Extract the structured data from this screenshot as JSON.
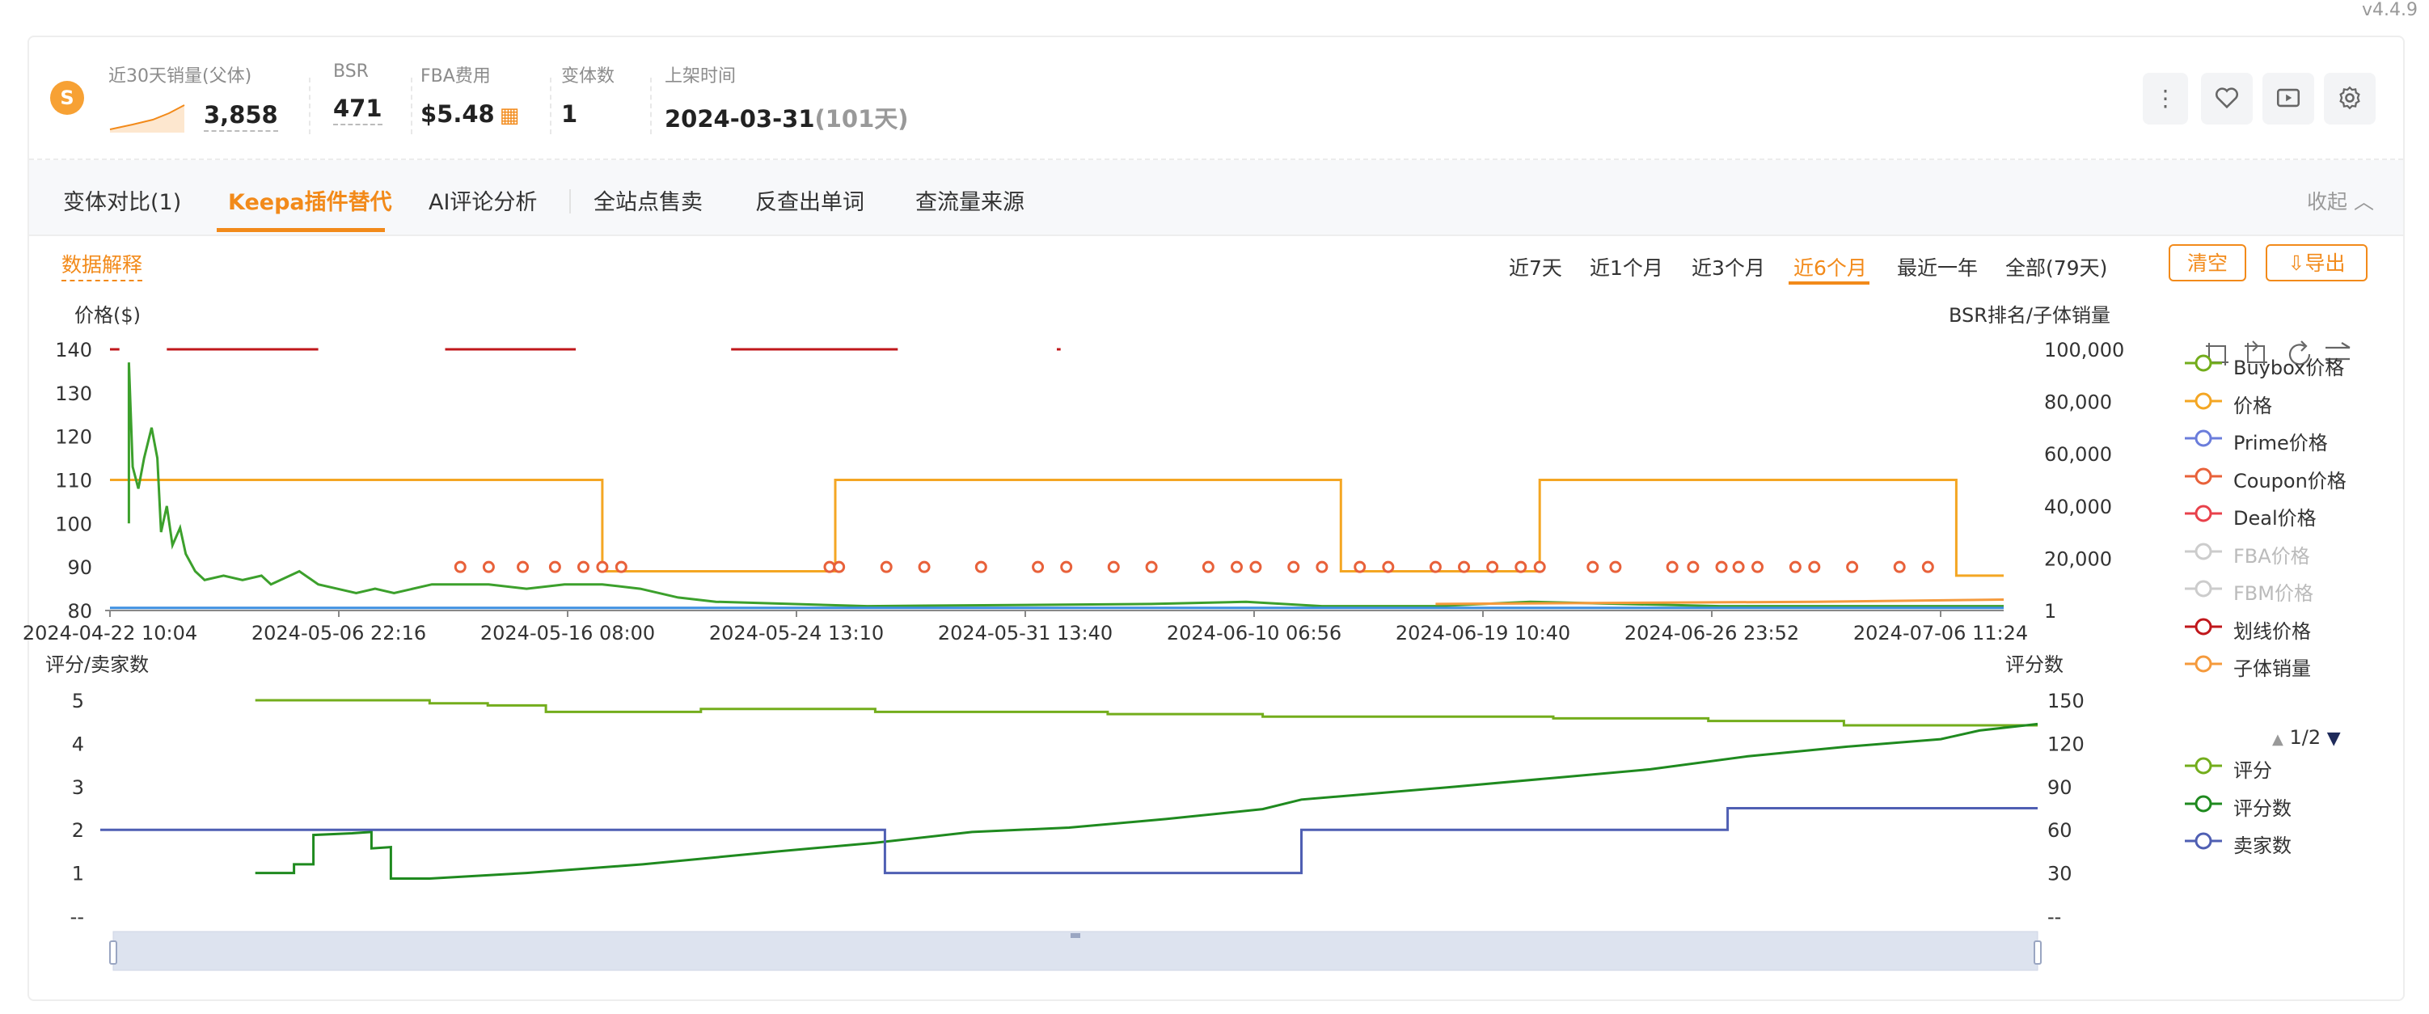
{
  "version": "v4.4.9",
  "header": {
    "stats": [
      {
        "label": "近30天销量(父体)",
        "value": "3,858"
      },
      {
        "label": "BSR",
        "value": "471"
      },
      {
        "label": "FBA费用",
        "value": "$5.48"
      },
      {
        "label": "变体数",
        "value": "1"
      },
      {
        "label": "上架时间",
        "value": "2024-03-31",
        "suffix": "(101天)"
      }
    ],
    "icons": [
      "more-icon",
      "heart-icon",
      "video-icon",
      "settings-icon"
    ]
  },
  "tabs": [
    {
      "label": "变体对比(1)"
    },
    {
      "label": "Keepa插件替代",
      "active": true
    },
    {
      "label": "AI评论分析"
    },
    {
      "label": "全站点售卖"
    },
    {
      "label": "反查出单词"
    },
    {
      "label": "查流量来源"
    }
  ],
  "collapse_label": "收起",
  "explain_label": "数据解释",
  "ranges": [
    {
      "label": "近7天"
    },
    {
      "label": "近1个月"
    },
    {
      "label": "近3个月"
    },
    {
      "label": "近6个月",
      "active": true
    },
    {
      "label": "最近一年"
    },
    {
      "label": "全部(79天)"
    }
  ],
  "buttons": {
    "clear": "清空",
    "export": "导出"
  },
  "legend_top": [
    {
      "name": "Buybox价格",
      "color": "#73ad1c",
      "on": true
    },
    {
      "name": "价格",
      "color": "#f4a623",
      "on": true
    },
    {
      "name": "Prime价格",
      "color": "#6b7ddb",
      "on": true
    },
    {
      "name": "Coupon价格",
      "color": "#e8613a",
      "on": true
    },
    {
      "name": "Deal价格",
      "color": "#e8414b",
      "on": true
    },
    {
      "name": "FBA价格",
      "color": "#cccccc",
      "on": false
    },
    {
      "name": "FBM价格",
      "color": "#cccccc",
      "on": false
    },
    {
      "name": "划线价格",
      "color": "#c0171b",
      "on": true
    },
    {
      "name": "子体销量",
      "color": "#f59a3c",
      "on": true
    }
  ],
  "legend_pager": "1/2",
  "legend_bottom": [
    {
      "name": "评分",
      "color": "#73ad1c"
    },
    {
      "name": "评分数",
      "color": "#1f8a1f"
    },
    {
      "name": "卖家数",
      "color": "#4f5fb3"
    }
  ],
  "chart_data": [
    {
      "type": "line",
      "ylabel": "价格($)",
      "y2label": "BSR排名/子体销量",
      "ylim": [
        80,
        140
      ],
      "y_ticks": [
        140,
        130,
        120,
        110,
        100,
        90,
        80
      ],
      "y2_ticks": [
        "100,000",
        "80,000",
        "60,000",
        "40,000",
        "20,000",
        "1"
      ],
      "x_ticks": [
        "2024-04-22 10:04",
        "2024-05-06 22:16",
        "2024-05-16 08:00",
        "2024-05-24 13:10",
        "2024-05-31 13:40",
        "2024-06-10 06:56",
        "2024-06-19 10:40",
        "2024-06-26 23:52",
        "2024-07-06 11:24"
      ],
      "series": [
        {
          "name": "价格",
          "color": "#f4a623",
          "points": [
            [
              0,
              110
            ],
            [
              0.26,
              110
            ],
            [
              0.26,
              89
            ],
            [
              0.383,
              89
            ],
            [
              0.383,
              110
            ],
            [
              0.65,
              110
            ],
            [
              0.65,
              89
            ],
            [
              0.755,
              89
            ],
            [
              0.755,
              110
            ],
            [
              0.975,
              110
            ],
            [
              0.975,
              88
            ],
            [
              1,
              88
            ]
          ]
        },
        {
          "name": "划线价格",
          "color": "#c0171b",
          "segments": [
            [
              [
                0.0,
                140
              ],
              [
                0.005,
                140
              ]
            ],
            [
              [
                0.03,
                140
              ],
              [
                0.11,
                140
              ]
            ],
            [
              [
                0.177,
                140
              ],
              [
                0.246,
                140
              ]
            ],
            [
              [
                0.328,
                140
              ],
              [
                0.416,
                140
              ]
            ],
            [
              [
                0.5,
                140
              ],
              [
                0.502,
                140
              ]
            ]
          ]
        },
        {
          "name": "Coupon价格",
          "color": "#e8613a",
          "dots": [
            [
              0.185,
              90
            ],
            [
              0.2,
              90
            ],
            [
              0.218,
              90
            ],
            [
              0.235,
              90
            ],
            [
              0.25,
              90
            ],
            [
              0.26,
              90
            ],
            [
              0.27,
              90
            ],
            [
              0.38,
              90
            ],
            [
              0.385,
              90
            ],
            [
              0.41,
              90
            ],
            [
              0.43,
              90
            ],
            [
              0.46,
              90
            ],
            [
              0.49,
              90
            ],
            [
              0.505,
              90
            ],
            [
              0.53,
              90
            ],
            [
              0.55,
              90
            ],
            [
              0.58,
              90
            ],
            [
              0.595,
              90
            ],
            [
              0.605,
              90
            ],
            [
              0.625,
              90
            ],
            [
              0.64,
              90
            ],
            [
              0.66,
              90
            ],
            [
              0.675,
              90
            ],
            [
              0.7,
              90
            ],
            [
              0.715,
              90
            ],
            [
              0.73,
              90
            ],
            [
              0.745,
              90
            ],
            [
              0.755,
              90
            ],
            [
              0.783,
              90
            ],
            [
              0.795,
              90
            ],
            [
              0.825,
              90
            ],
            [
              0.836,
              90
            ],
            [
              0.851,
              90
            ],
            [
              0.86,
              90
            ],
            [
              0.87,
              90
            ],
            [
              0.89,
              90
            ],
            [
              0.9,
              90
            ],
            [
              0.92,
              90
            ],
            [
              0.945,
              90
            ],
            [
              0.96,
              90
            ]
          ]
        },
        {
          "name": "Buybox价格",
          "color": "#3ca02c",
          "points": [
            [
              0.01,
              100
            ],
            [
              0.01,
              137
            ],
            [
              0.012,
              113
            ],
            [
              0.015,
              108
            ],
            [
              0.018,
              115
            ],
            [
              0.022,
              122
            ],
            [
              0.025,
              115
            ],
            [
              0.027,
              98
            ],
            [
              0.03,
              104
            ],
            [
              0.033,
              95
            ],
            [
              0.037,
              99
            ],
            [
              0.04,
              93
            ],
            [
              0.045,
              89
            ],
            [
              0.05,
              87
            ],
            [
              0.06,
              88
            ],
            [
              0.07,
              87
            ],
            [
              0.08,
              88
            ],
            [
              0.085,
              86
            ],
            [
              0.1,
              89
            ],
            [
              0.11,
              86
            ],
            [
              0.12,
              85
            ],
            [
              0.13,
              84
            ],
            [
              0.14,
              85
            ],
            [
              0.15,
              84
            ],
            [
              0.17,
              86
            ],
            [
              0.2,
              86
            ],
            [
              0.22,
              85
            ],
            [
              0.24,
              86
            ],
            [
              0.26,
              86
            ],
            [
              0.28,
              85
            ],
            [
              0.3,
              83
            ],
            [
              0.32,
              82
            ],
            [
              0.4,
              81
            ],
            [
              0.55,
              81.5
            ],
            [
              0.6,
              82
            ],
            [
              0.64,
              81
            ],
            [
              0.66,
              81
            ],
            [
              0.7,
              81
            ],
            [
              0.75,
              82
            ],
            [
              0.85,
              81
            ],
            [
              0.95,
              81
            ],
            [
              1,
              81
            ]
          ]
        },
        {
          "name": "子体销量",
          "color": "#f59a3c",
          "points": [
            [
              0.7,
              81.5
            ],
            [
              0.9,
              82
            ],
            [
              1,
              82.5
            ]
          ]
        },
        {
          "name": "Prime价格",
          "color": "#3d8fe0",
          "points": [
            [
              0,
              80.6
            ],
            [
              1,
              80.6
            ]
          ]
        }
      ]
    },
    {
      "type": "line",
      "ylabel": "评分/卖家数",
      "y2label": "评分数",
      "y_ticks": [
        "5",
        "4",
        "3",
        "2",
        "1",
        "--"
      ],
      "y2_ticks": [
        "150",
        "120",
        "90",
        "60",
        "30",
        "--"
      ],
      "series": [
        {
          "name": "评分",
          "color": "#73ad1c",
          "points": [
            [
              0.08,
              5
            ],
            [
              0.17,
              5
            ],
            [
              0.17,
              4.93
            ],
            [
              0.2,
              4.93
            ],
            [
              0.2,
              4.88
            ],
            [
              0.23,
              4.88
            ],
            [
              0.23,
              4.73
            ],
            [
              0.31,
              4.73
            ],
            [
              0.31,
              4.8
            ],
            [
              0.4,
              4.8
            ],
            [
              0.4,
              4.73
            ],
            [
              0.52,
              4.73
            ],
            [
              0.52,
              4.68
            ],
            [
              0.6,
              4.68
            ],
            [
              0.6,
              4.62
            ],
            [
              0.75,
              4.62
            ],
            [
              0.75,
              4.58
            ],
            [
              0.83,
              4.58
            ],
            [
              0.83,
              4.52
            ],
            [
              0.9,
              4.52
            ],
            [
              0.9,
              4.42
            ],
            [
              1,
              4.42
            ]
          ]
        },
        {
          "name": "评分数",
          "color": "#1f8a1f",
          "points": [
            [
              0.08,
              1
            ],
            [
              0.1,
              1
            ],
            [
              0.1,
              1.2
            ],
            [
              0.11,
              1.2
            ],
            [
              0.11,
              1.88
            ],
            [
              0.13,
              1.92
            ],
            [
              0.14,
              1.95
            ],
            [
              0.14,
              1.57
            ],
            [
              0.15,
              1.6
            ],
            [
              0.15,
              0.87
            ],
            [
              0.17,
              0.87
            ],
            [
              0.22,
              1.0
            ],
            [
              0.28,
              1.2
            ],
            [
              0.35,
              1.5
            ],
            [
              0.4,
              1.7
            ],
            [
              0.45,
              1.95
            ],
            [
              0.5,
              2.05
            ],
            [
              0.55,
              2.25
            ],
            [
              0.6,
              2.48
            ],
            [
              0.62,
              2.7
            ],
            [
              0.7,
              3.0
            ],
            [
              0.75,
              3.2
            ],
            [
              0.8,
              3.4
            ],
            [
              0.85,
              3.7
            ],
            [
              0.9,
              3.92
            ],
            [
              0.95,
              4.1
            ],
            [
              0.97,
              4.3
            ],
            [
              1,
              4.45
            ]
          ]
        },
        {
          "name": "卖家数",
          "color": "#4f5fb3",
          "points": [
            [
              0,
              2
            ],
            [
              0.405,
              2
            ],
            [
              0.405,
              1
            ],
            [
              0.62,
              1
            ],
            [
              0.62,
              2
            ],
            [
              0.84,
              2
            ],
            [
              0.84,
              2.5
            ],
            [
              1,
              2.5
            ]
          ]
        }
      ]
    }
  ]
}
